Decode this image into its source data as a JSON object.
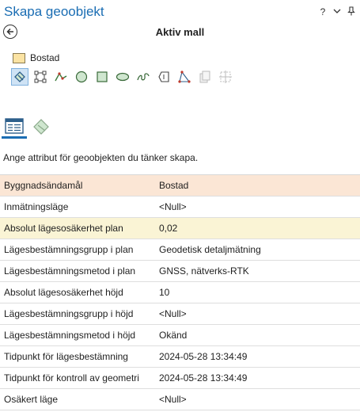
{
  "pane": {
    "title": "Skapa geoobjekt",
    "controls": {
      "help": "?",
      "menu": "⌄",
      "pin": "📌"
    }
  },
  "header": {
    "title": "Aktiv mall"
  },
  "template": {
    "name": "Bostad",
    "color": "#fbe3a3"
  },
  "tools": [
    "edit-vertices-icon",
    "rectangle-select-icon",
    "line-icon",
    "circle-icon",
    "square-icon",
    "ellipse-icon",
    "freehand-icon",
    "trace-icon",
    "right-angle-icon",
    "copy-icon",
    "split-icon"
  ],
  "tabs": [
    "attributes-icon",
    "geometry-icon"
  ],
  "hint": "Ange attribut för geoobjekten du tänker skapa.",
  "attributes": [
    {
      "key": "Byggnadsändamål",
      "value": "Bostad",
      "highlight": "orange"
    },
    {
      "key": "Inmätningsläge",
      "value": "<Null>",
      "highlight": ""
    },
    {
      "key": "Absolut lägesosäkerhet plan",
      "value": "0,02",
      "highlight": "yellow"
    },
    {
      "key": "Lägesbestämningsgrupp i plan",
      "value": "Geodetisk detaljmätning",
      "highlight": ""
    },
    {
      "key": "Lägesbestämningsmetod i plan",
      "value": "GNSS, nätverks-RTK",
      "highlight": ""
    },
    {
      "key": "Absolut lägesosäkerhet höjd",
      "value": "10",
      "highlight": ""
    },
    {
      "key": "Lägesbestämningsgrupp i höjd",
      "value": "<Null>",
      "highlight": ""
    },
    {
      "key": "Lägesbestämningsmetod i höjd",
      "value": "Okänd",
      "highlight": ""
    },
    {
      "key": "Tidpunkt för lägesbestämning",
      "value": "2024-05-28 13:34:49",
      "highlight": ""
    },
    {
      "key": "Tidpunkt för kontroll av geometri",
      "value": "2024-05-28 13:34:49",
      "highlight": ""
    },
    {
      "key": "Osäkert läge",
      "value": "<Null>",
      "highlight": ""
    }
  ]
}
